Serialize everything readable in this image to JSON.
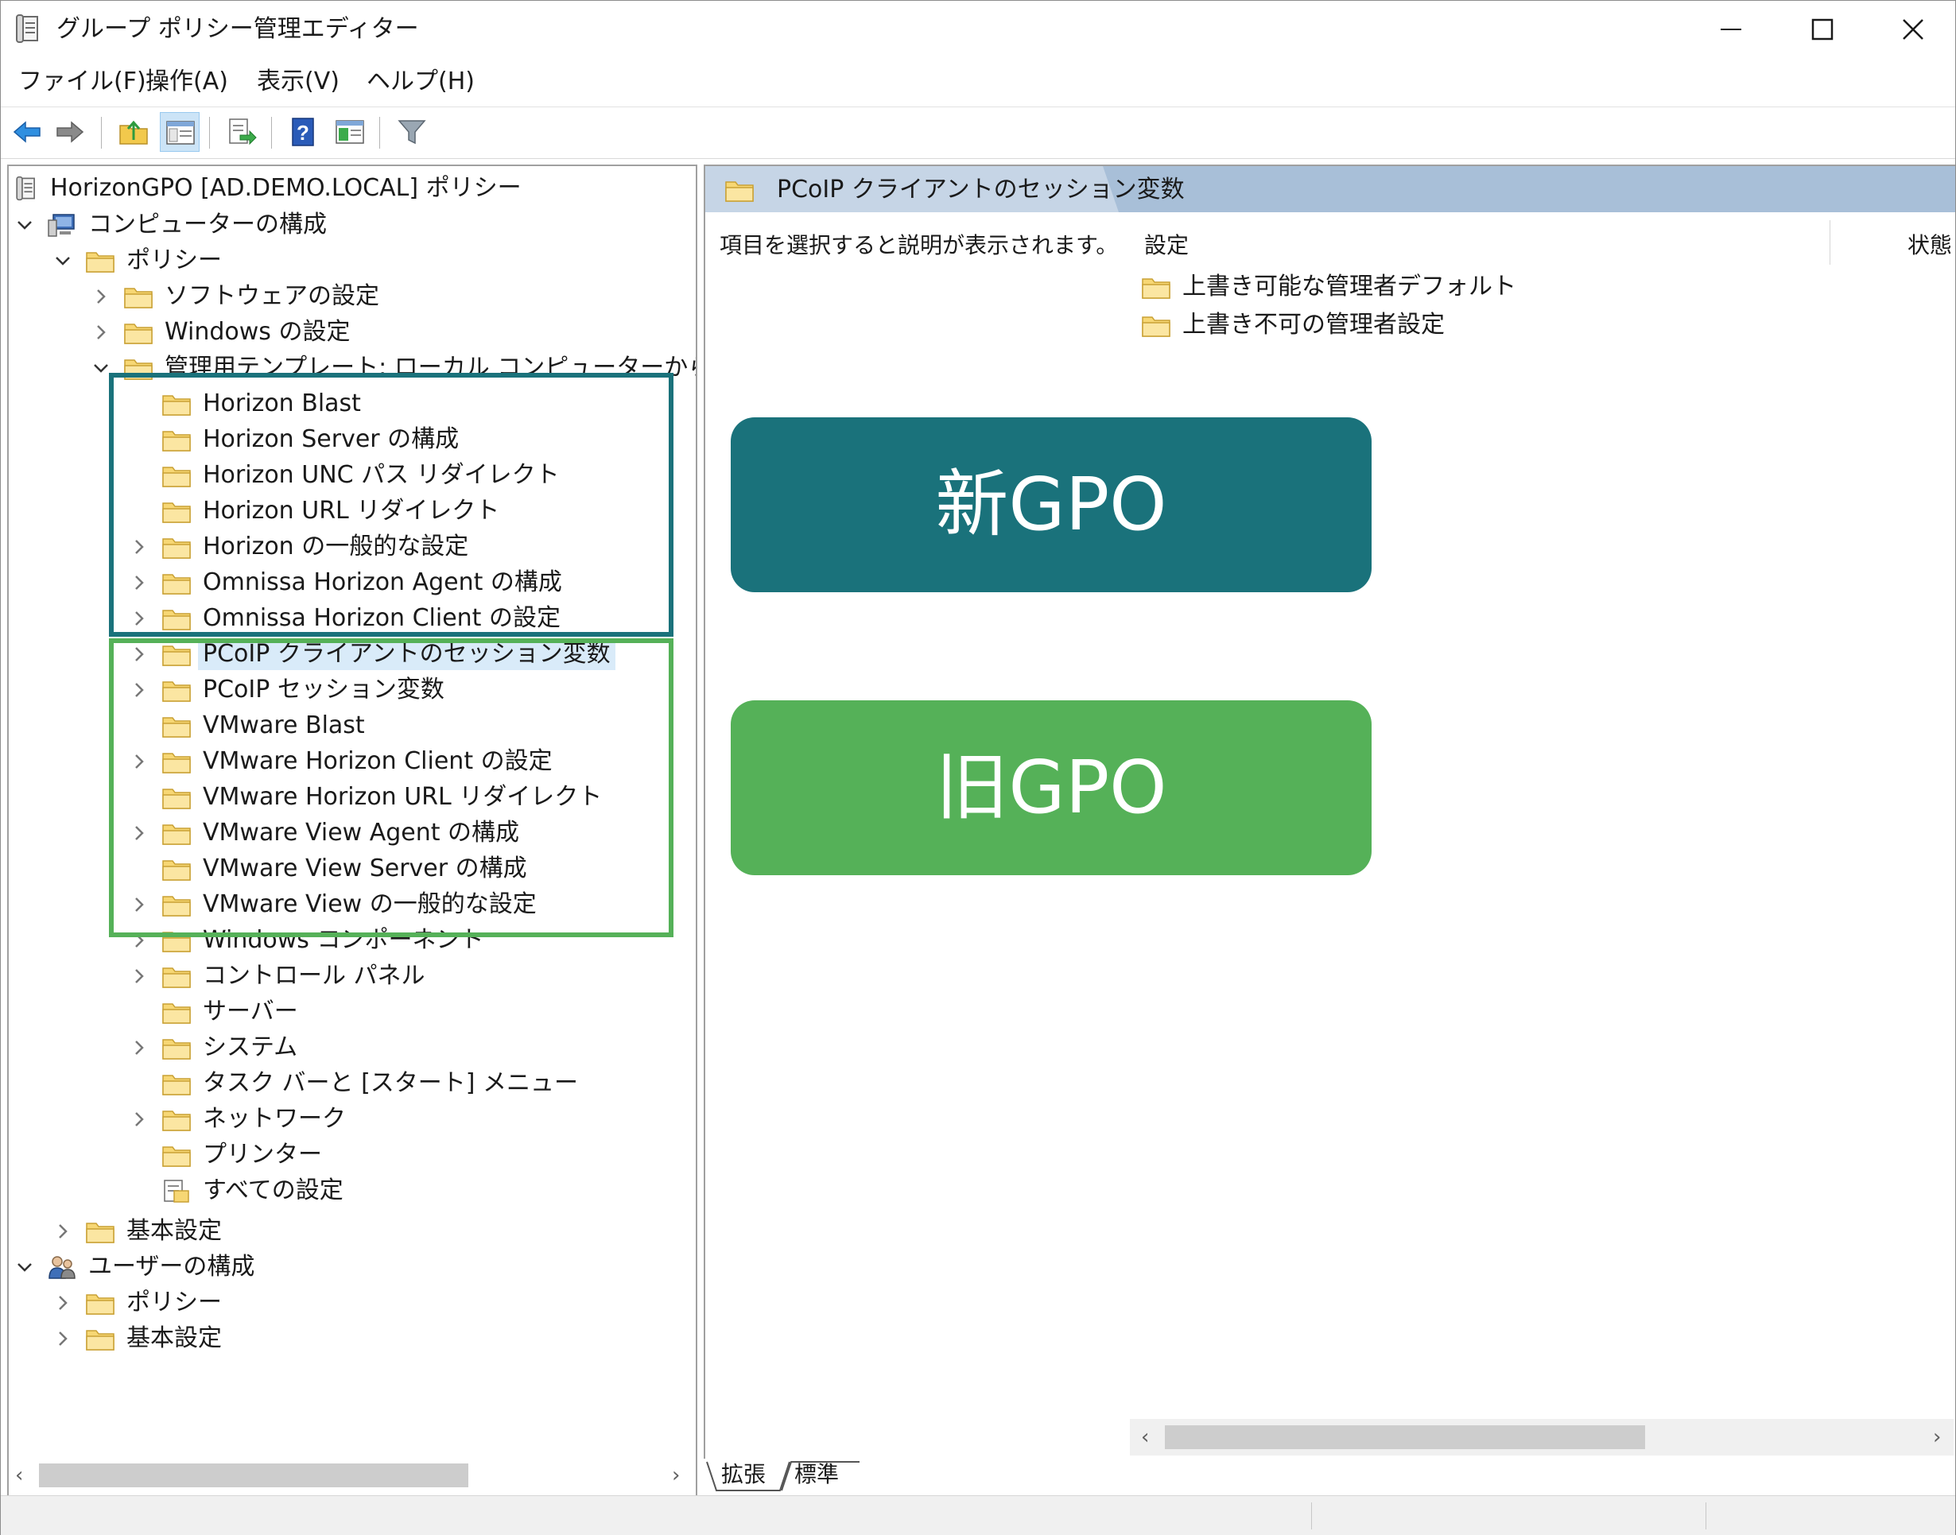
{
  "window": {
    "title": "グループ ポリシー管理エディター"
  },
  "menu": {
    "items": [
      "ファイル(F)",
      "操作(A)",
      "表示(V)",
      "ヘルプ(H)"
    ]
  },
  "toolbar": {
    "buttons": [
      {
        "icon": "back-arrow-icon"
      },
      {
        "icon": "forward-arrow-icon"
      },
      {
        "icon": "up-folder-icon"
      },
      {
        "icon": "show-hide-tree-icon",
        "active": true
      },
      {
        "icon": "export-list-icon"
      },
      {
        "icon": "help-icon"
      },
      {
        "icon": "properties-icon"
      },
      {
        "icon": "filter-icon"
      }
    ]
  },
  "tree": {
    "root": "HorizonGPO [AD.DEMO.LOCAL] ポリシー",
    "computer_config": "コンピューターの構成",
    "policies": "ポリシー",
    "software_settings": "ソフトウェアの設定",
    "windows_settings": "Windows の設定",
    "admin_templates": "管理用テンプレート: ローカル コンピューターから取得したポリ",
    "template_items": [
      {
        "label": "Horizon Blast",
        "expandable": false
      },
      {
        "label": "Horizon Server の構成",
        "expandable": false
      },
      {
        "label": "Horizon UNC パス リダイレクト",
        "expandable": false
      },
      {
        "label": "Horizon URL リダイレクト",
        "expandable": false
      },
      {
        "label": "Horizon の一般的な設定",
        "expandable": true
      },
      {
        "label": "Omnissa Horizon Agent の構成",
        "expandable": true
      },
      {
        "label": "Omnissa Horizon Client の設定",
        "expandable": true
      },
      {
        "label": "PCoIP クライアントのセッション変数",
        "expandable": true,
        "selected": true
      },
      {
        "label": "PCoIP セッション変数",
        "expandable": true
      },
      {
        "label": "VMware Blast",
        "expandable": false
      },
      {
        "label": "VMware Horizon Client の設定",
        "expandable": true
      },
      {
        "label": "VMware Horizon URL リダイレクト",
        "expandable": false
      },
      {
        "label": "VMware View Agent の構成",
        "expandable": true
      },
      {
        "label": "VMware View Server の構成",
        "expandable": false
      },
      {
        "label": "VMware View の一般的な設定",
        "expandable": true
      },
      {
        "label": "Windows コンポーネント",
        "expandable": true
      },
      {
        "label": "コントロール パネル",
        "expandable": true
      },
      {
        "label": "サーバー",
        "expandable": false
      },
      {
        "label": "システム",
        "expandable": true
      },
      {
        "label": "タスク バーと [スタート] メニュー",
        "expandable": false
      },
      {
        "label": "ネットワーク",
        "expandable": true
      },
      {
        "label": "プリンター",
        "expandable": false
      },
      {
        "label": "すべての設定",
        "expandable": false,
        "icon": "all-settings-icon"
      }
    ],
    "basic_settings": "基本設定",
    "user_config": "ユーザーの構成",
    "user_policies": "ポリシー",
    "user_basic_settings": "基本設定"
  },
  "details": {
    "header_title": "PCoIP クライアントのセッション変数",
    "description": "項目を選択すると説明が表示されます。",
    "col_setting": "設定",
    "col_state": "状態",
    "items": [
      "上書き可能な管理者デフォルト",
      "上書き不可の管理者設定"
    ]
  },
  "bottom_tabs": [
    "拡張",
    "標準"
  ],
  "annotations": {
    "new_label": "新GPO",
    "old_label": "旧GPO",
    "new_color": "#1a727b",
    "old_color": "#55b158"
  }
}
